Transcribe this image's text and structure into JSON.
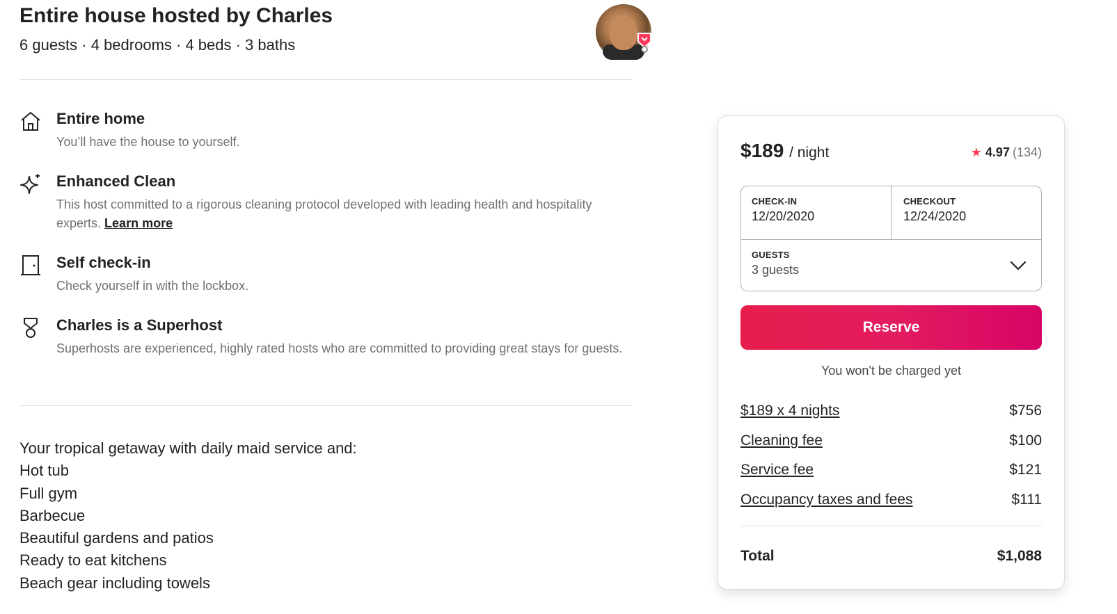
{
  "listing": {
    "title": "Entire house hosted by Charles",
    "summary": "6 guests · 4 bedrooms · 4 beds · 3 baths",
    "host_avatar_icon": "host-avatar"
  },
  "features": [
    {
      "icon": "house-icon",
      "title": "Entire home",
      "description": "You’ll have the house to yourself."
    },
    {
      "icon": "sparkle-icon",
      "title": "Enhanced Clean",
      "description": "This host committed to a rigorous cleaning protocol developed with leading health and hospitality experts.",
      "link": "Learn more"
    },
    {
      "icon": "door-icon",
      "title": "Self check-in",
      "description": "Check yourself in with the lockbox."
    },
    {
      "icon": "medal-icon",
      "title": "Charles is a Superhost",
      "description": "Superhosts are experienced, highly rated hosts who are committed to providing great stays for guests."
    }
  ],
  "description": {
    "intro": "Your tropical getaway with daily maid service and:",
    "amenities": [
      "Hot tub",
      "Full gym",
      "Barbecue",
      "Beautiful gardens and patios",
      "Ready to eat kitchens",
      "Beach gear including towels"
    ]
  },
  "booking": {
    "price": "$189",
    "per": "/ night",
    "rating": "4.97",
    "reviews": "(134)",
    "checkin_label": "CHECK-IN",
    "checkin_value": "12/20/2020",
    "checkout_label": "CHECKOUT",
    "checkout_value": "12/24/2020",
    "guests_label": "GUESTS",
    "guests_value": "3 guests",
    "reserve_label": "Reserve",
    "no_charge": "You won't be charged yet",
    "line_items": [
      {
        "label": "$189 x 4 nights",
        "amount": "$756"
      },
      {
        "label": "Cleaning fee",
        "amount": "$100"
      },
      {
        "label": "Service fee",
        "amount": "$121"
      },
      {
        "label": "Occupancy taxes and fees",
        "amount": "$111"
      }
    ],
    "total_label": "Total",
    "total_amount": "$1,088"
  },
  "colors": {
    "brand": "#ff385c",
    "reserve_start": "#e61e4d",
    "reserve_end": "#d70466",
    "muted_text": "#717171"
  }
}
